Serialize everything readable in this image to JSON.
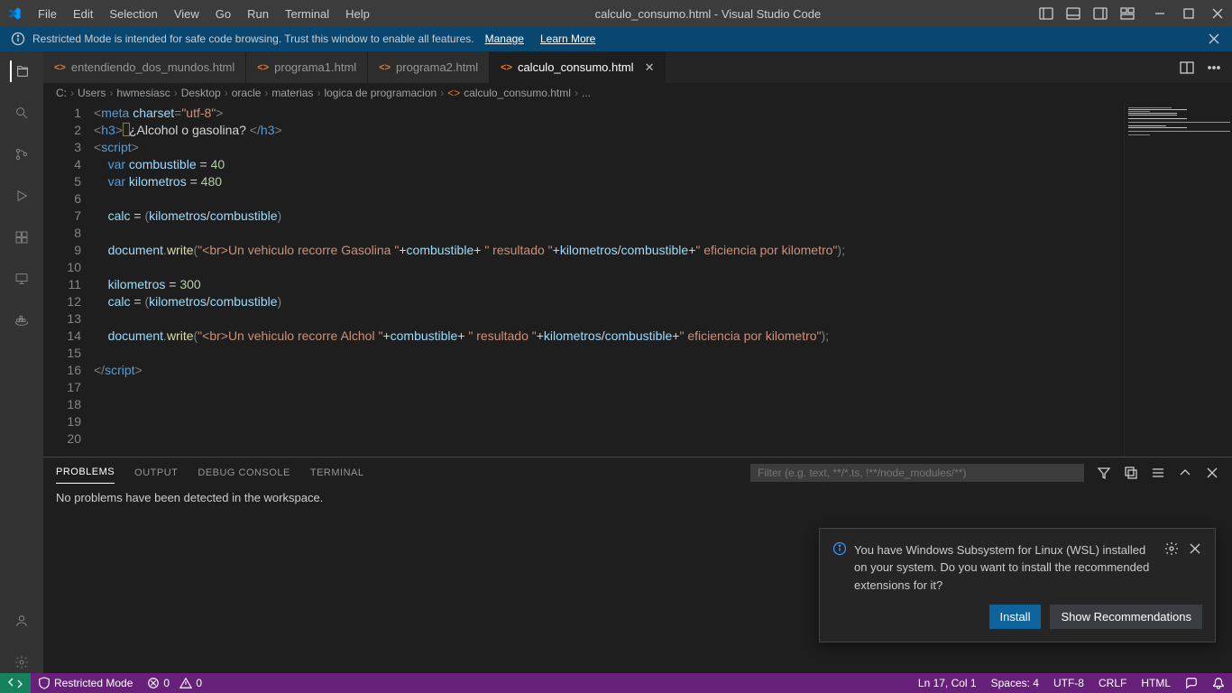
{
  "window": {
    "title": "calculo_consumo.html - Visual Studio Code"
  },
  "menu": [
    "File",
    "Edit",
    "Selection",
    "View",
    "Go",
    "Run",
    "Terminal",
    "Help"
  ],
  "notification": {
    "text": "Restricted Mode is intended for safe code browsing. Trust this window to enable all features.",
    "manage": "Manage",
    "learn": "Learn More"
  },
  "tabs": [
    {
      "label": "entendiendo_dos_mundos.html",
      "active": false
    },
    {
      "label": "programa1.html",
      "active": false
    },
    {
      "label": "programa2.html",
      "active": false
    },
    {
      "label": "calculo_consumo.html",
      "active": true
    }
  ],
  "breadcrumb": [
    "C:",
    "Users",
    "hwmesiasc",
    "Desktop",
    "oracle",
    "materias",
    "logica de programacion",
    "calculo_consumo.html",
    "..."
  ],
  "code_lines": 20,
  "panel": {
    "tabs": [
      "PROBLEMS",
      "OUTPUT",
      "DEBUG CONSOLE",
      "TERMINAL"
    ],
    "active": "PROBLEMS",
    "filter_placeholder": "Filter (e.g. text, **/*.ts, !**/node_modules/**)",
    "body": "No problems have been detected in the workspace."
  },
  "status": {
    "restricted": "Restricted Mode",
    "errors": "0",
    "warnings": "0",
    "ln_col": "Ln 17, Col 1",
    "spaces": "Spaces: 4",
    "encoding": "UTF-8",
    "eol": "CRLF",
    "lang": "HTML"
  },
  "toast": {
    "text": "You have Windows Subsystem for Linux (WSL) installed on your system. Do you want to install the recommended extensions for it?",
    "install": "Install",
    "show": "Show Recommendations"
  }
}
